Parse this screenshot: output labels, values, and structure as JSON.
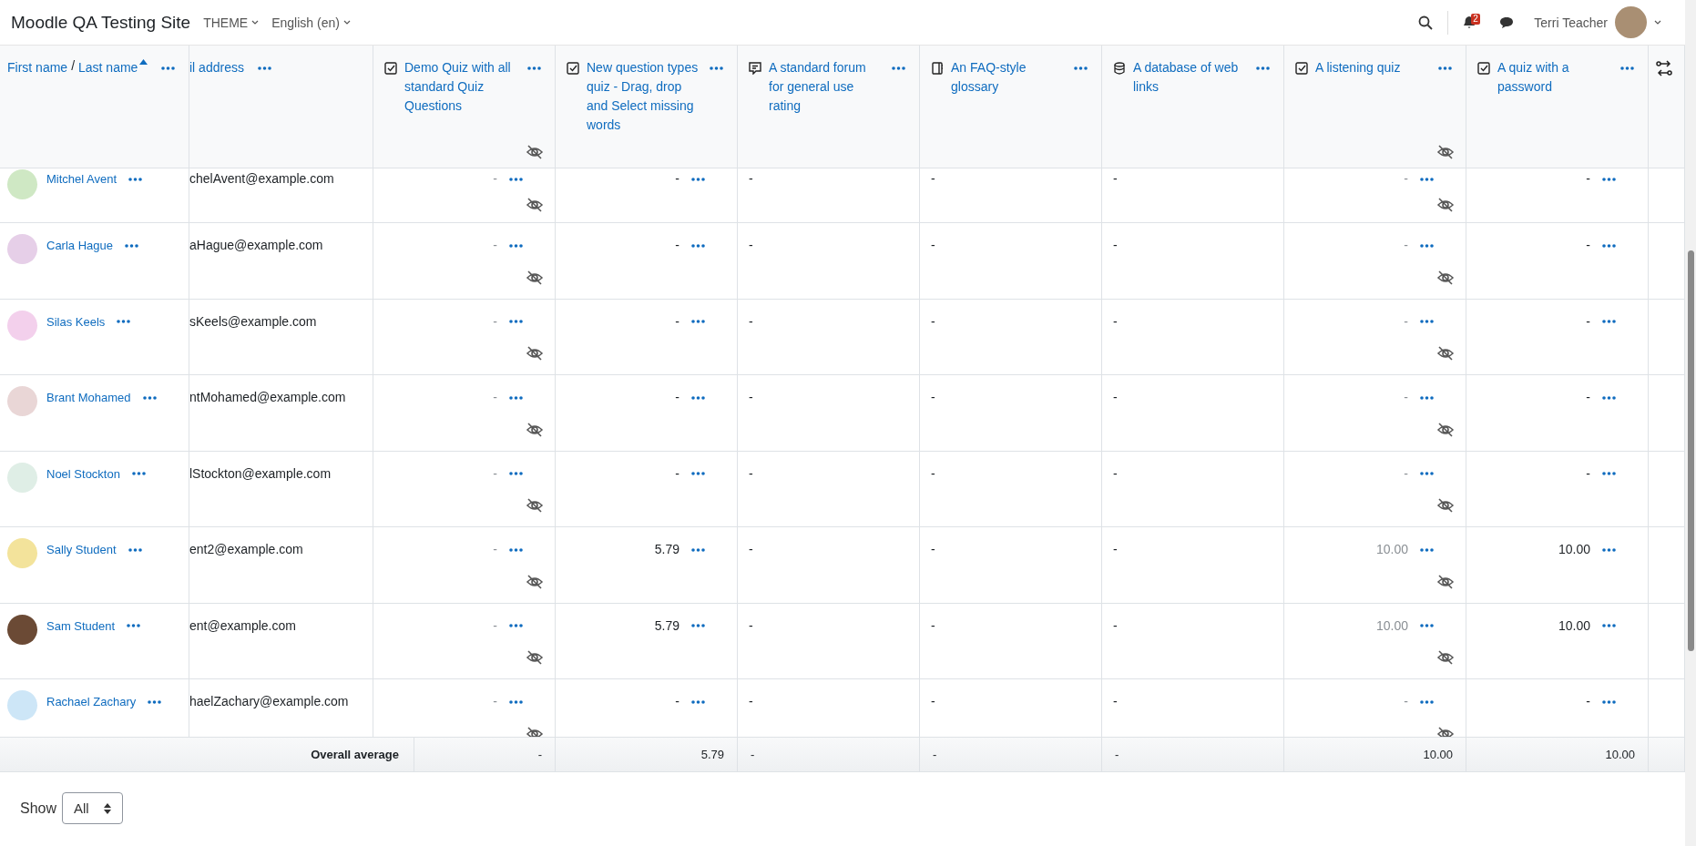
{
  "navbar": {
    "site_name": "Moodle QA Testing Site",
    "menus": [
      "THEME",
      "English (en)"
    ],
    "notification_count": "2",
    "user_name": "Terri Teacher"
  },
  "table": {
    "name_header": {
      "separator": "/",
      "fields": [
        {
          "label": "First name",
          "sorted": false
        },
        {
          "label": "Last name",
          "sorted": true
        }
      ]
    },
    "email_header": "il address",
    "columns": [
      {
        "kind": "quiz",
        "title": "Demo Quiz with all standard Quiz Questions",
        "hidden": true
      },
      {
        "kind": "quiz",
        "title": "New question types quiz - Drag, drop and Select missing words",
        "hidden": false
      },
      {
        "kind": "forum",
        "title": "A standard forum for general use rating",
        "hidden": false
      },
      {
        "kind": "glossary",
        "title": "An FAQ-style glossary",
        "hidden": false
      },
      {
        "kind": "database",
        "title": "A database of web links",
        "hidden": false
      },
      {
        "kind": "quiz",
        "title": "A listening quiz",
        "hidden": true
      },
      {
        "kind": "quiz",
        "title": "A quiz with a password",
        "hidden": false
      }
    ],
    "rows": [
      {
        "name": "Mitchel Avent",
        "email": "chelAvent@example.com",
        "grades": [
          "-",
          "-",
          "-",
          "-",
          "-",
          "-",
          "-"
        ]
      },
      {
        "name": "Carla Hague",
        "email": "aHague@example.com",
        "grades": [
          "-",
          "-",
          "-",
          "-",
          "-",
          "-",
          "-"
        ]
      },
      {
        "name": "Silas Keels",
        "email": "sKeels@example.com",
        "grades": [
          "-",
          "-",
          "-",
          "-",
          "-",
          "-",
          "-"
        ]
      },
      {
        "name": "Brant Mohamed",
        "email": "ntMohamed@example.com",
        "grades": [
          "-",
          "-",
          "-",
          "-",
          "-",
          "-",
          "-"
        ]
      },
      {
        "name": "Noel Stockton",
        "email": "lStockton@example.com",
        "grades": [
          "-",
          "-",
          "-",
          "-",
          "-",
          "-",
          "-"
        ]
      },
      {
        "name": "Sally Student",
        "email": "ent2@example.com",
        "grades": [
          "-",
          "5.79",
          "-",
          "-",
          "-",
          "10.00",
          "10.00"
        ]
      },
      {
        "name": "Sam Student",
        "email": "ent@example.com",
        "grades": [
          "-",
          "5.79",
          "-",
          "-",
          "-",
          "10.00",
          "10.00"
        ]
      },
      {
        "name": "Rachael Zachary",
        "email": "haelZachary@example.com",
        "grades": [
          "-",
          "-",
          "-",
          "-",
          "-",
          "-",
          "-"
        ]
      }
    ],
    "average": {
      "label": "Overall average",
      "values": [
        "-",
        "5.79",
        "-",
        "-",
        "-",
        "10.00",
        "10.00"
      ]
    }
  },
  "pager": {
    "label": "Show",
    "value": "All"
  }
}
